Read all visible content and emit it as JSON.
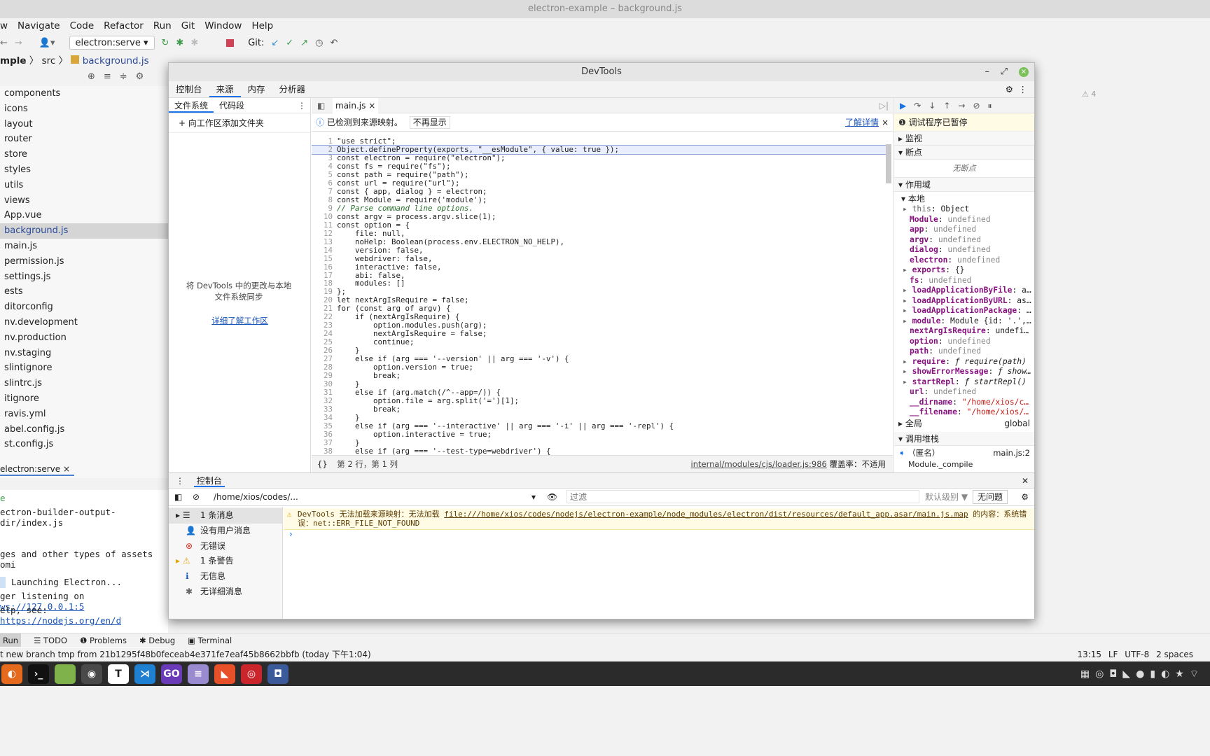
{
  "ide": {
    "window_title": "electron-example – background.js",
    "menu": [
      "w",
      "Navigate",
      "Code",
      "Refactor",
      "Run",
      "Git",
      "Window",
      "Help"
    ],
    "run_config": "electron:serve",
    "git_label": "Git:",
    "breadcrumb": [
      "mple",
      "src",
      "background.js"
    ],
    "tree": [
      "components",
      "icons",
      "layout",
      "router",
      "store",
      "styles",
      "utils",
      "views",
      "App.vue",
      "background.js",
      "main.js",
      "permission.js",
      "settings.js",
      "ests",
      "ditorconfig",
      "nv.development",
      "nv.production",
      "nv.staging",
      "slintignore",
      "slintrc.js",
      "itignore",
      "ravis.yml",
      "abel.config.js",
      "st.config.js"
    ],
    "selected_tree_item": "background.js",
    "run_tab": "electron:serve",
    "run_lines": [
      "e",
      "ectron-builder-output-dir/index.js",
      "ges and other types of assets omi",
      "Launching Electron...",
      "ger listening on ",
      "elp, see: "
    ],
    "run_links": [
      "ws://127.0.0.1:5",
      "https://nodejs.org/en/d"
    ],
    "warning_count": "4",
    "bottom_tabs": [
      "Run",
      "TODO",
      "Problems",
      "Debug",
      "Terminal"
    ],
    "status_left": "t new branch tmp from 21b1295f48b0feceab4e371fe7eaf45b8662bbfb (today 下午1:04)",
    "status_right": [
      "13:15",
      "LF",
      "UTF-8",
      "2 spaces"
    ]
  },
  "devtools": {
    "title": "DevTools",
    "tabs": [
      "控制台",
      "来源",
      "内存",
      "分析器"
    ],
    "active_tab": "来源",
    "nav_tabs": [
      "文件系统",
      "代码段"
    ],
    "add_folder": "+ 向工作区添加文件夹",
    "sync_text": "将 DevTools 中的更改与本地文件系统同步",
    "learn_workspace": "详细了解工作区",
    "file_tab": "main.js",
    "sourcemap_notice": "已检测到来源映射。",
    "dont_show": "不再显示",
    "learn_more": "了解详情",
    "code": [
      "\"use strict\";",
      "Object.defineProperty(exports, \"__esModule\", { value: true });",
      "const electron = require(\"electron\");",
      "const fs = require(\"fs\");",
      "const path = require(\"path\");",
      "const url = require(\"url\");",
      "const { app, dialog } = electron;",
      "const Module = require('module');",
      "// Parse command line options.",
      "const argv = process.argv.slice(1);",
      "const option = {",
      "    file: null,",
      "    noHelp: Boolean(process.env.ELECTRON_NO_HELP),",
      "    version: false,",
      "    webdriver: false,",
      "    interactive: false,",
      "    abi: false,",
      "    modules: []",
      "};",
      "let nextArgIsRequire = false;",
      "for (const arg of argv) {",
      "    if (nextArgIsRequire) {",
      "        option.modules.push(arg);",
      "        nextArgIsRequire = false;",
      "        continue;",
      "    }",
      "    else if (arg === '--version' || arg === '-v') {",
      "        option.version = true;",
      "        break;",
      "    }",
      "    else if (arg.match(/^--app=/)) {",
      "        option.file = arg.split('=')[1];",
      "        break;",
      "    }",
      "    else if (arg === '--interactive' || arg === '-i' || arg === '-repl') {",
      "        option.interactive = true;",
      "    }",
      "    else if (arg === '--test-type=webdriver') {"
    ],
    "cursor_pos": "第 2 行，第 1 列",
    "source_link": "internal/modules/cjs/loader.js:986",
    "coverage": "覆盖率：不适用",
    "paused": "调试程序已暂停",
    "watch": "监视",
    "breakpoints": "断点",
    "no_breakpoints": "无断点",
    "scope": "作用域",
    "local": "本地",
    "scope_items": [
      {
        "k": "this",
        "v": "Object",
        "exp": true
      },
      {
        "k": "Module",
        "v": "undefined"
      },
      {
        "k": "app",
        "v": "undefined"
      },
      {
        "k": "argv",
        "v": "undefined"
      },
      {
        "k": "dialog",
        "v": "undefined"
      },
      {
        "k": "electron",
        "v": "undefined"
      },
      {
        "k": "exports",
        "v": "{}",
        "exp": true
      },
      {
        "k": "fs",
        "v": "undefined"
      },
      {
        "k": "loadApplicationByFile",
        "v": "a…",
        "exp": true
      },
      {
        "k": "loadApplicationByURL",
        "v": "as…",
        "exp": true
      },
      {
        "k": "loadApplicationPackage",
        "v": "…",
        "exp": true
      },
      {
        "k": "module",
        "v": "Module {id: '.',…",
        "exp": true
      },
      {
        "k": "nextArgIsRequire",
        "v": "undefi…"
      },
      {
        "k": "option",
        "v": "undefined"
      },
      {
        "k": "path",
        "v": "undefined"
      },
      {
        "k": "require",
        "v": "ƒ require(path)",
        "exp": true
      },
      {
        "k": "showErrorMessage",
        "v": "ƒ show…",
        "exp": true
      },
      {
        "k": "startRepl",
        "v": "ƒ startRepl()",
        "exp": true
      },
      {
        "k": "url",
        "v": "undefined"
      },
      {
        "k": "__dirname",
        "v": "\"/home/xios/c…"
      },
      {
        "k": "__filename",
        "v": "\"/home/xios/…"
      }
    ],
    "global": "全局",
    "global_val": "global",
    "call_stack": "调用堆栈",
    "frame_name": "（匿名）",
    "frame_loc": "main.js:2",
    "frame2": "Module._compile",
    "console_title": "控制台",
    "context": "/home/xios/codes/...",
    "filter_placeholder": "过滤",
    "levels": "默认级别 ▼",
    "no_issues": "无问题",
    "console_side": [
      "1 条消息",
      "没有用户消息",
      "无错误",
      "1 条警告",
      "无信息",
      "无详细消息"
    ],
    "warn_msg_a": "DevTools 无法加载来源映射：无法加载 ",
    "warn_link": "file:///home/xios/codes/nodejs/electron-example/node_modules/electron/dist/resources/default_app.asar/main.js.map",
    "warn_msg_b": " 的内容：系统错误：net::ERR_FILE_NOT_FOUND"
  }
}
